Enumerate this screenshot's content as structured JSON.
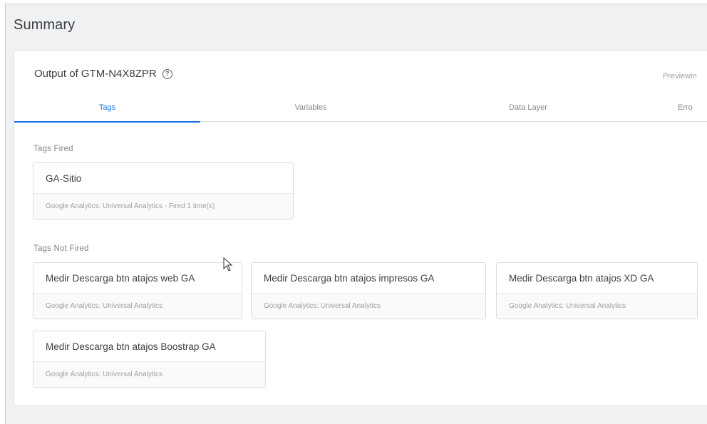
{
  "summary": {
    "title": "Summary"
  },
  "container": {
    "title": "Output of GTM-N4X8ZPR",
    "help_icon": "help-circle-icon",
    "previewing": "Previewin"
  },
  "tabs": [
    {
      "label": "Tags",
      "active": true
    },
    {
      "label": "Variables",
      "active": false
    },
    {
      "label": "Data Layer",
      "active": false
    },
    {
      "label": "Erro",
      "active": false
    }
  ],
  "tags_fired": {
    "label": "Tags Fired",
    "items": [
      {
        "name": "GA-Sitio",
        "type": "Google Analytics: Universal Analytics - Fired 1 time(s)"
      }
    ]
  },
  "tags_not_fired": {
    "label": "Tags Not Fired",
    "items": [
      {
        "name": "Medir Descarga btn atajos web GA",
        "type": "Google Analytics: Universal Analytics"
      },
      {
        "name": "Medir Descarga btn atajos impresos GA",
        "type": "Google Analytics: Universal Analytics"
      },
      {
        "name": "Medir Descarga btn atajos XD GA",
        "type": "Google Analytics: Universal Analytics"
      },
      {
        "name": "Medir Descarga btn atajos Boostrap GA",
        "type": "Google Analytics: Universal Analytics"
      }
    ]
  },
  "colors": {
    "accent": "#1a73e8",
    "background": "#f0f1f3"
  }
}
